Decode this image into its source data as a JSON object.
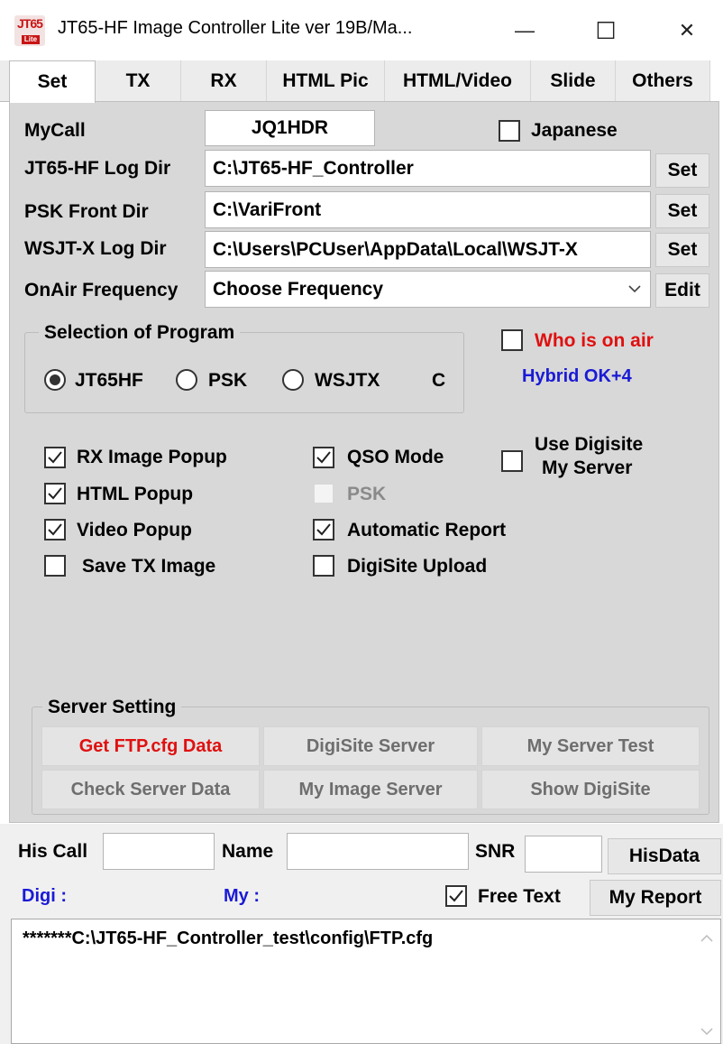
{
  "window": {
    "icon_text_top": "JT65",
    "icon_text_bottom": "Lite",
    "title": "JT65-HF Image Controller Lite ver 19B/Ma...",
    "minimize": "—",
    "maximize": "☐",
    "close": "✕"
  },
  "tabs": [
    "Set",
    "TX",
    "RX",
    "HTML Pic",
    "HTML/Video",
    "Slide",
    "Others"
  ],
  "set_tab": {
    "mycall_label": "MyCall",
    "mycall_value": "JQ1HDR",
    "japanese_label": "Japanese",
    "japanese_checked": false,
    "log_dir_label": "JT65-HF Log Dir",
    "log_dir_value": "C:\\JT65-HF_Controller",
    "psk_dir_label": "PSK Front Dir",
    "psk_dir_value": "C:\\VariFront",
    "wsjtx_dir_label": "WSJT-X Log Dir",
    "wsjtx_dir_value": "C:\\Users\\PCUser\\AppData\\Local\\WSJT-X",
    "set_button": "Set",
    "onair_label": "OnAir Frequency",
    "onair_value": "Choose Frequency",
    "edit_button": "Edit",
    "program_group": {
      "title": "Selection of Program",
      "options": [
        "JT65HF",
        "PSK",
        "WSJTX"
      ],
      "selected": "JT65HF",
      "trailing": "C"
    },
    "who_on_air_label": "Who is on air",
    "who_on_air_color": "#e01010",
    "hybrid_label": "Hybrid OK+4",
    "hybrid_color": "#1a1ad6",
    "checks": {
      "rx_image_popup": {
        "label": "RX Image Popup",
        "checked": true
      },
      "html_popup": {
        "label": "HTML Popup",
        "checked": true
      },
      "video_popup": {
        "label": "Video Popup",
        "checked": true
      },
      "save_tx_image": {
        "label": "Save TX Image",
        "checked": false
      },
      "qso_mode": {
        "label": "QSO Mode",
        "checked": true
      },
      "psk": {
        "label": "PSK",
        "checked": false,
        "disabled": true
      },
      "automatic_report": {
        "label": "Automatic  Report",
        "checked": true
      },
      "digisite_upload": {
        "label": "DigiSite Upload",
        "checked": false
      },
      "use_digisite_line1": "Use Digisite",
      "use_digisite_line2": "My Server"
    },
    "server_group": {
      "title": "Server Setting",
      "buttons": [
        "Get FTP.cfg Data",
        "DigiSite Server",
        "My Server Test",
        "Check Server Data",
        "My Image Server",
        "Show DigiSite"
      ],
      "highlight_color": "#e01010"
    }
  },
  "bottom": {
    "his_call_label": "His Call",
    "his_call_value": "",
    "name_label": "Name",
    "name_value": "",
    "snr_label": "SNR",
    "snr_value": "",
    "hisdata_button": "HisData",
    "digi_label": "Digi :",
    "my_label": "My :",
    "label_color": "#1a1ad6",
    "free_text_label": "Free Text",
    "free_text_checked": true,
    "my_report_button": "My Report",
    "log_text": "*******C:\\JT65-HF_Controller_test\\config\\FTP.cfg"
  }
}
